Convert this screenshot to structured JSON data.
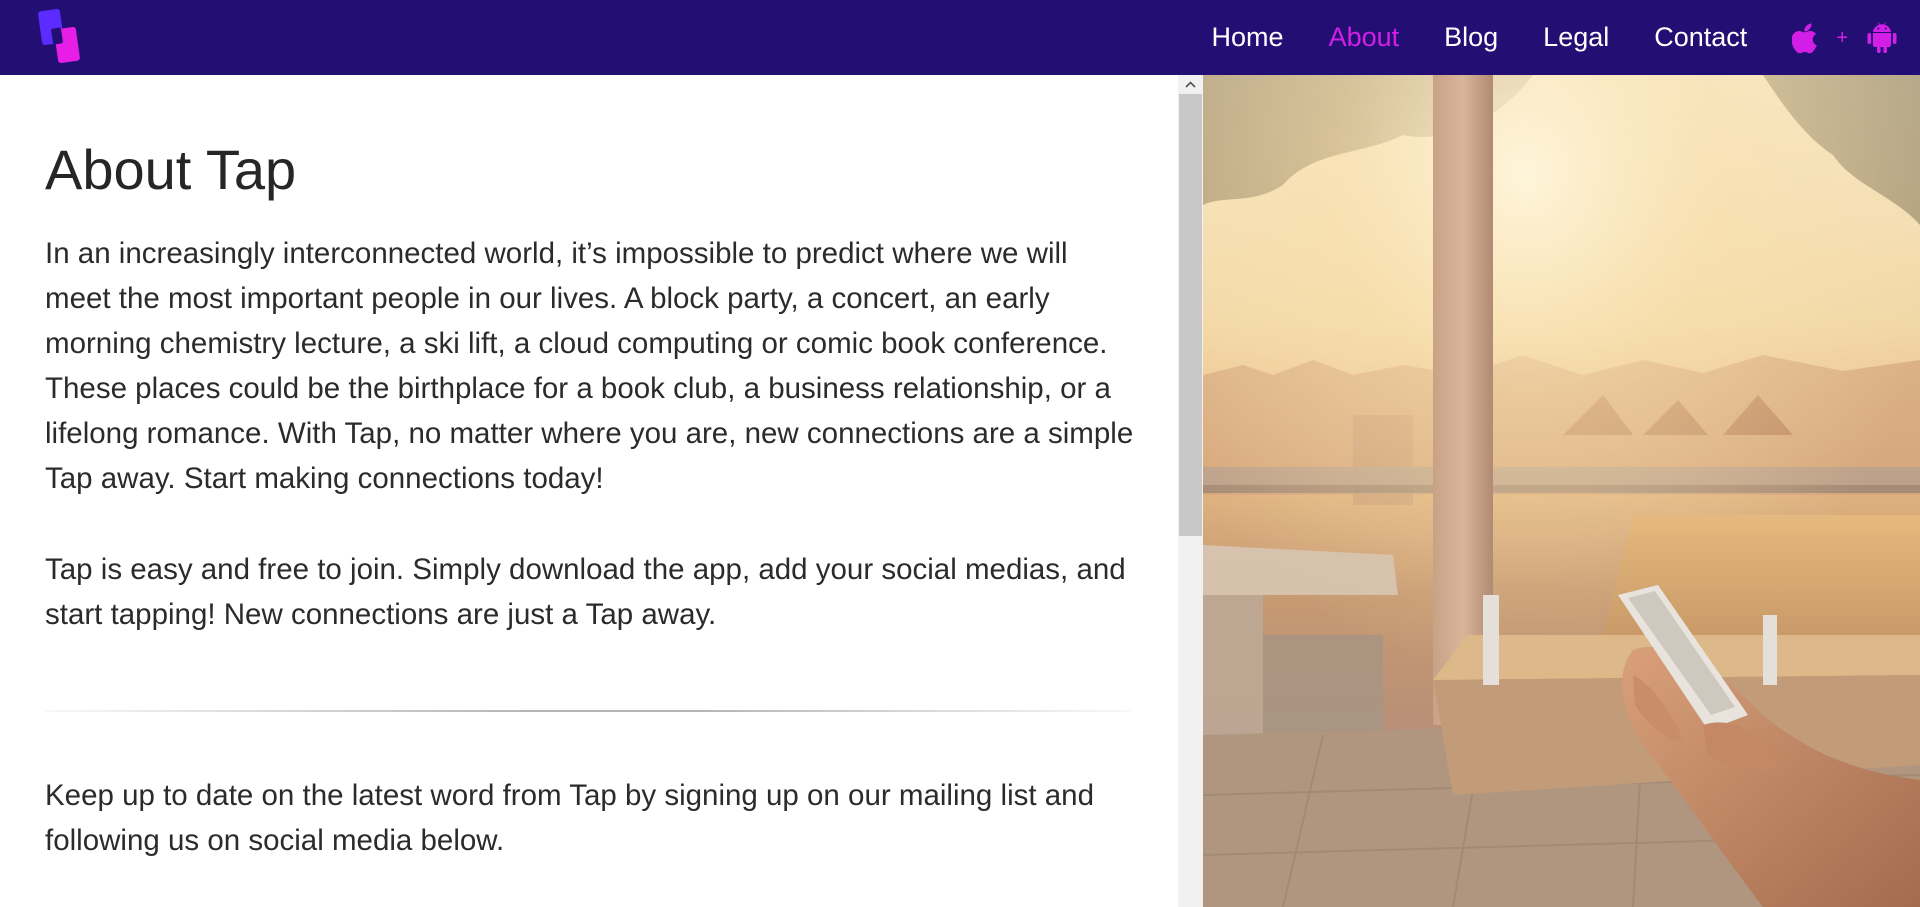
{
  "nav": {
    "logo": "tap-logo",
    "links": [
      {
        "label": "Home",
        "active": false
      },
      {
        "label": "About",
        "active": true
      },
      {
        "label": "Blog",
        "active": false
      },
      {
        "label": "Legal",
        "active": false
      },
      {
        "label": "Contact",
        "active": false
      }
    ],
    "store_separator": "+",
    "store_icons": [
      "apple-icon",
      "android-icon"
    ],
    "colors": {
      "background": "#230f73",
      "accent": "#d21ee6",
      "text": "#ffffff"
    }
  },
  "main": {
    "title": "About Tap",
    "paragraphs": [
      "In an increasingly interconnected world, it’s impossible to predict where we will meet the most important people in our lives. A block party, a concert, an early morning chemistry lecture, a ski lift, a cloud computing or comic book conference. These places could be the birthplace for a book club, a business relationship, or a lifelong romance. With Tap, no matter where you are, new connections are a simple Tap away. Start making connections today!",
      "Tap is easy and free to join. Simply download the app, add your social medias, and start tapping! New connections are just a Tap away.",
      "Keep up to date on the latest word from Tap by signing up on our mailing list and following us on social media below."
    ]
  },
  "hero_image": {
    "subject": "hand-holding-phone-photo"
  }
}
